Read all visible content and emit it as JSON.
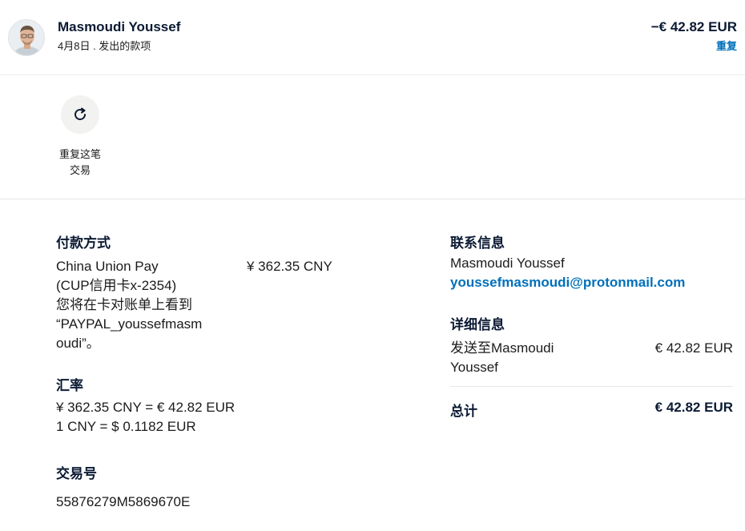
{
  "header": {
    "name": "Masmoudi Youssef",
    "meta": "4月8日 . 发出的款项",
    "amount": "−€ 42.82 EUR",
    "repeat_link": "重复"
  },
  "actions": {
    "repeat_label_line1": "重复这笔",
    "repeat_label_line2": "交易",
    "icon": "refresh-icon"
  },
  "payment": {
    "title": "付款方式",
    "method_lines": [
      "China Union Pay",
      "(CUP信用卡x-2354)",
      "您将在卡对账单上看到",
      "“PAYPAL_youssefmasm",
      "oudi”。"
    ],
    "amount": "¥ 362.35 CNY"
  },
  "exchange": {
    "title": "汇率",
    "line1": "¥ 362.35 CNY = € 42.82 EUR",
    "line2": "1 CNY = $ 0.1182 EUR"
  },
  "transaction": {
    "title": "交易号",
    "id": "55876279M5869670E"
  },
  "contact": {
    "title": "联系信息",
    "name": "Masmoudi Youssef",
    "email": "youssefmasmoudi@protonmail.com"
  },
  "details": {
    "title": "详细信息",
    "line1": "发送至Masmoudi",
    "line2": "Youssef",
    "amount": "€ 42.82 EUR"
  },
  "total": {
    "label": "总计",
    "value": "€ 42.82 EUR"
  },
  "colors": {
    "accent": "#0070ba",
    "heading": "#0b1a33"
  }
}
